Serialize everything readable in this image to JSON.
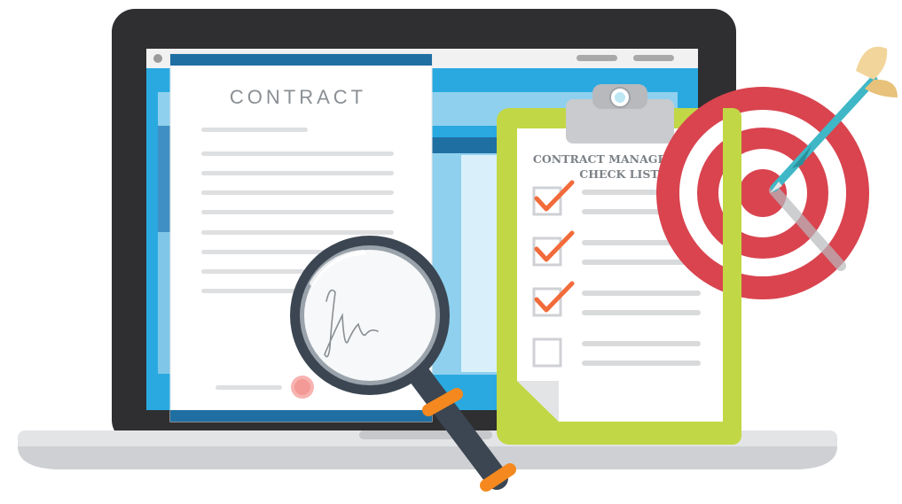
{
  "contract": {
    "title": "CONTRACT"
  },
  "checklist": {
    "title_line1": "CONTRACT MANAGEMENT",
    "title_line2": "CHECK LIST",
    "items": [
      {
        "checked": true
      },
      {
        "checked": true
      },
      {
        "checked": true
      },
      {
        "checked": false
      }
    ]
  },
  "colors": {
    "laptop_bezel": "#2f2f31",
    "laptop_base": "#e3e4e6",
    "screen_blue": "#29a9e0",
    "paper_header": "#1f6fa3",
    "clipboard": "#c2d745",
    "check_mark": "#f26b3a",
    "target_red": "#d9444f",
    "dart_teal": "#3fb7c6",
    "magnifier_handle": "#3b4652",
    "magnifier_grip": "#f5891f"
  },
  "icons": [
    "laptop-icon",
    "contract-document-icon",
    "signature-icon",
    "seal-icon",
    "magnifying-glass-icon",
    "clipboard-icon",
    "checkbox-icon",
    "target-icon",
    "dart-icon"
  ]
}
